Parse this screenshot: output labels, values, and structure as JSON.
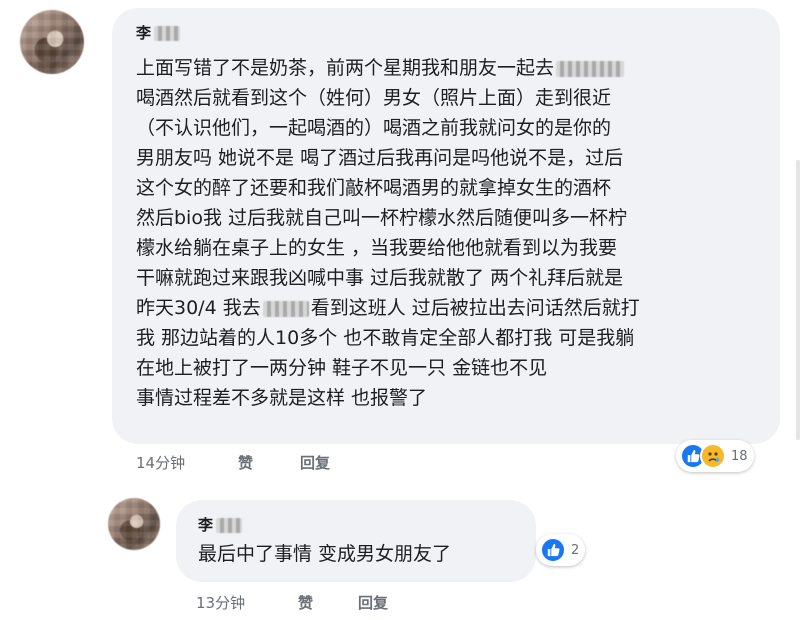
{
  "comment1": {
    "author": "李",
    "lines": [
      "上面写错了不是奶茶，前两个星期我和朋友一起去",
      "喝酒然后就看到这个（姓何）男女（照片上面）走到很近",
      "（不认识他们，一起喝酒的）喝酒之前我就问女的是你的",
      "男朋友吗 她说不是 喝了酒过后我再问是吗他说不是，过后",
      "这个女的醉了还要和我们敲杯喝酒男的就拿掉女生的酒杯",
      "然后bio我 过后我就自己叫一杯柠檬水然后随便叫多一杯柠",
      "檬水给躺在桌子上的女生 ，当我要给他他就看到以为我要",
      "干嘛就跑过来跟我凶喊中事 过后我就散了 两个礼拜后就是",
      "昨天30/4 我去",
      "看到这班人 过后被拉出去问话然后就打",
      "我 那边站着的人10多个 也不敢肯定全部人都打我 可是我躺",
      "在地上被打了一两分钟 鞋子不见一只 金链也不见",
      "事情过程差不多就是这样 也报警了"
    ],
    "time": "14分钟",
    "like_label": "赞",
    "reply_label": "回复",
    "reaction_count": "18",
    "reaction_icons": [
      "like-icon",
      "sad-face-icon"
    ]
  },
  "comment2": {
    "author": "李",
    "text": "最后中了事情 变成男女朋友了",
    "time": "13分钟",
    "like_label": "赞",
    "reply_label": "回复",
    "reaction_count": "2",
    "reaction_icons": [
      "like-icon"
    ]
  },
  "colors": {
    "bubble": "#f0f2f5",
    "like_blue": "#1877f2",
    "sad_yellow": "#f7b928",
    "meta_gray": "#6b6f76"
  }
}
